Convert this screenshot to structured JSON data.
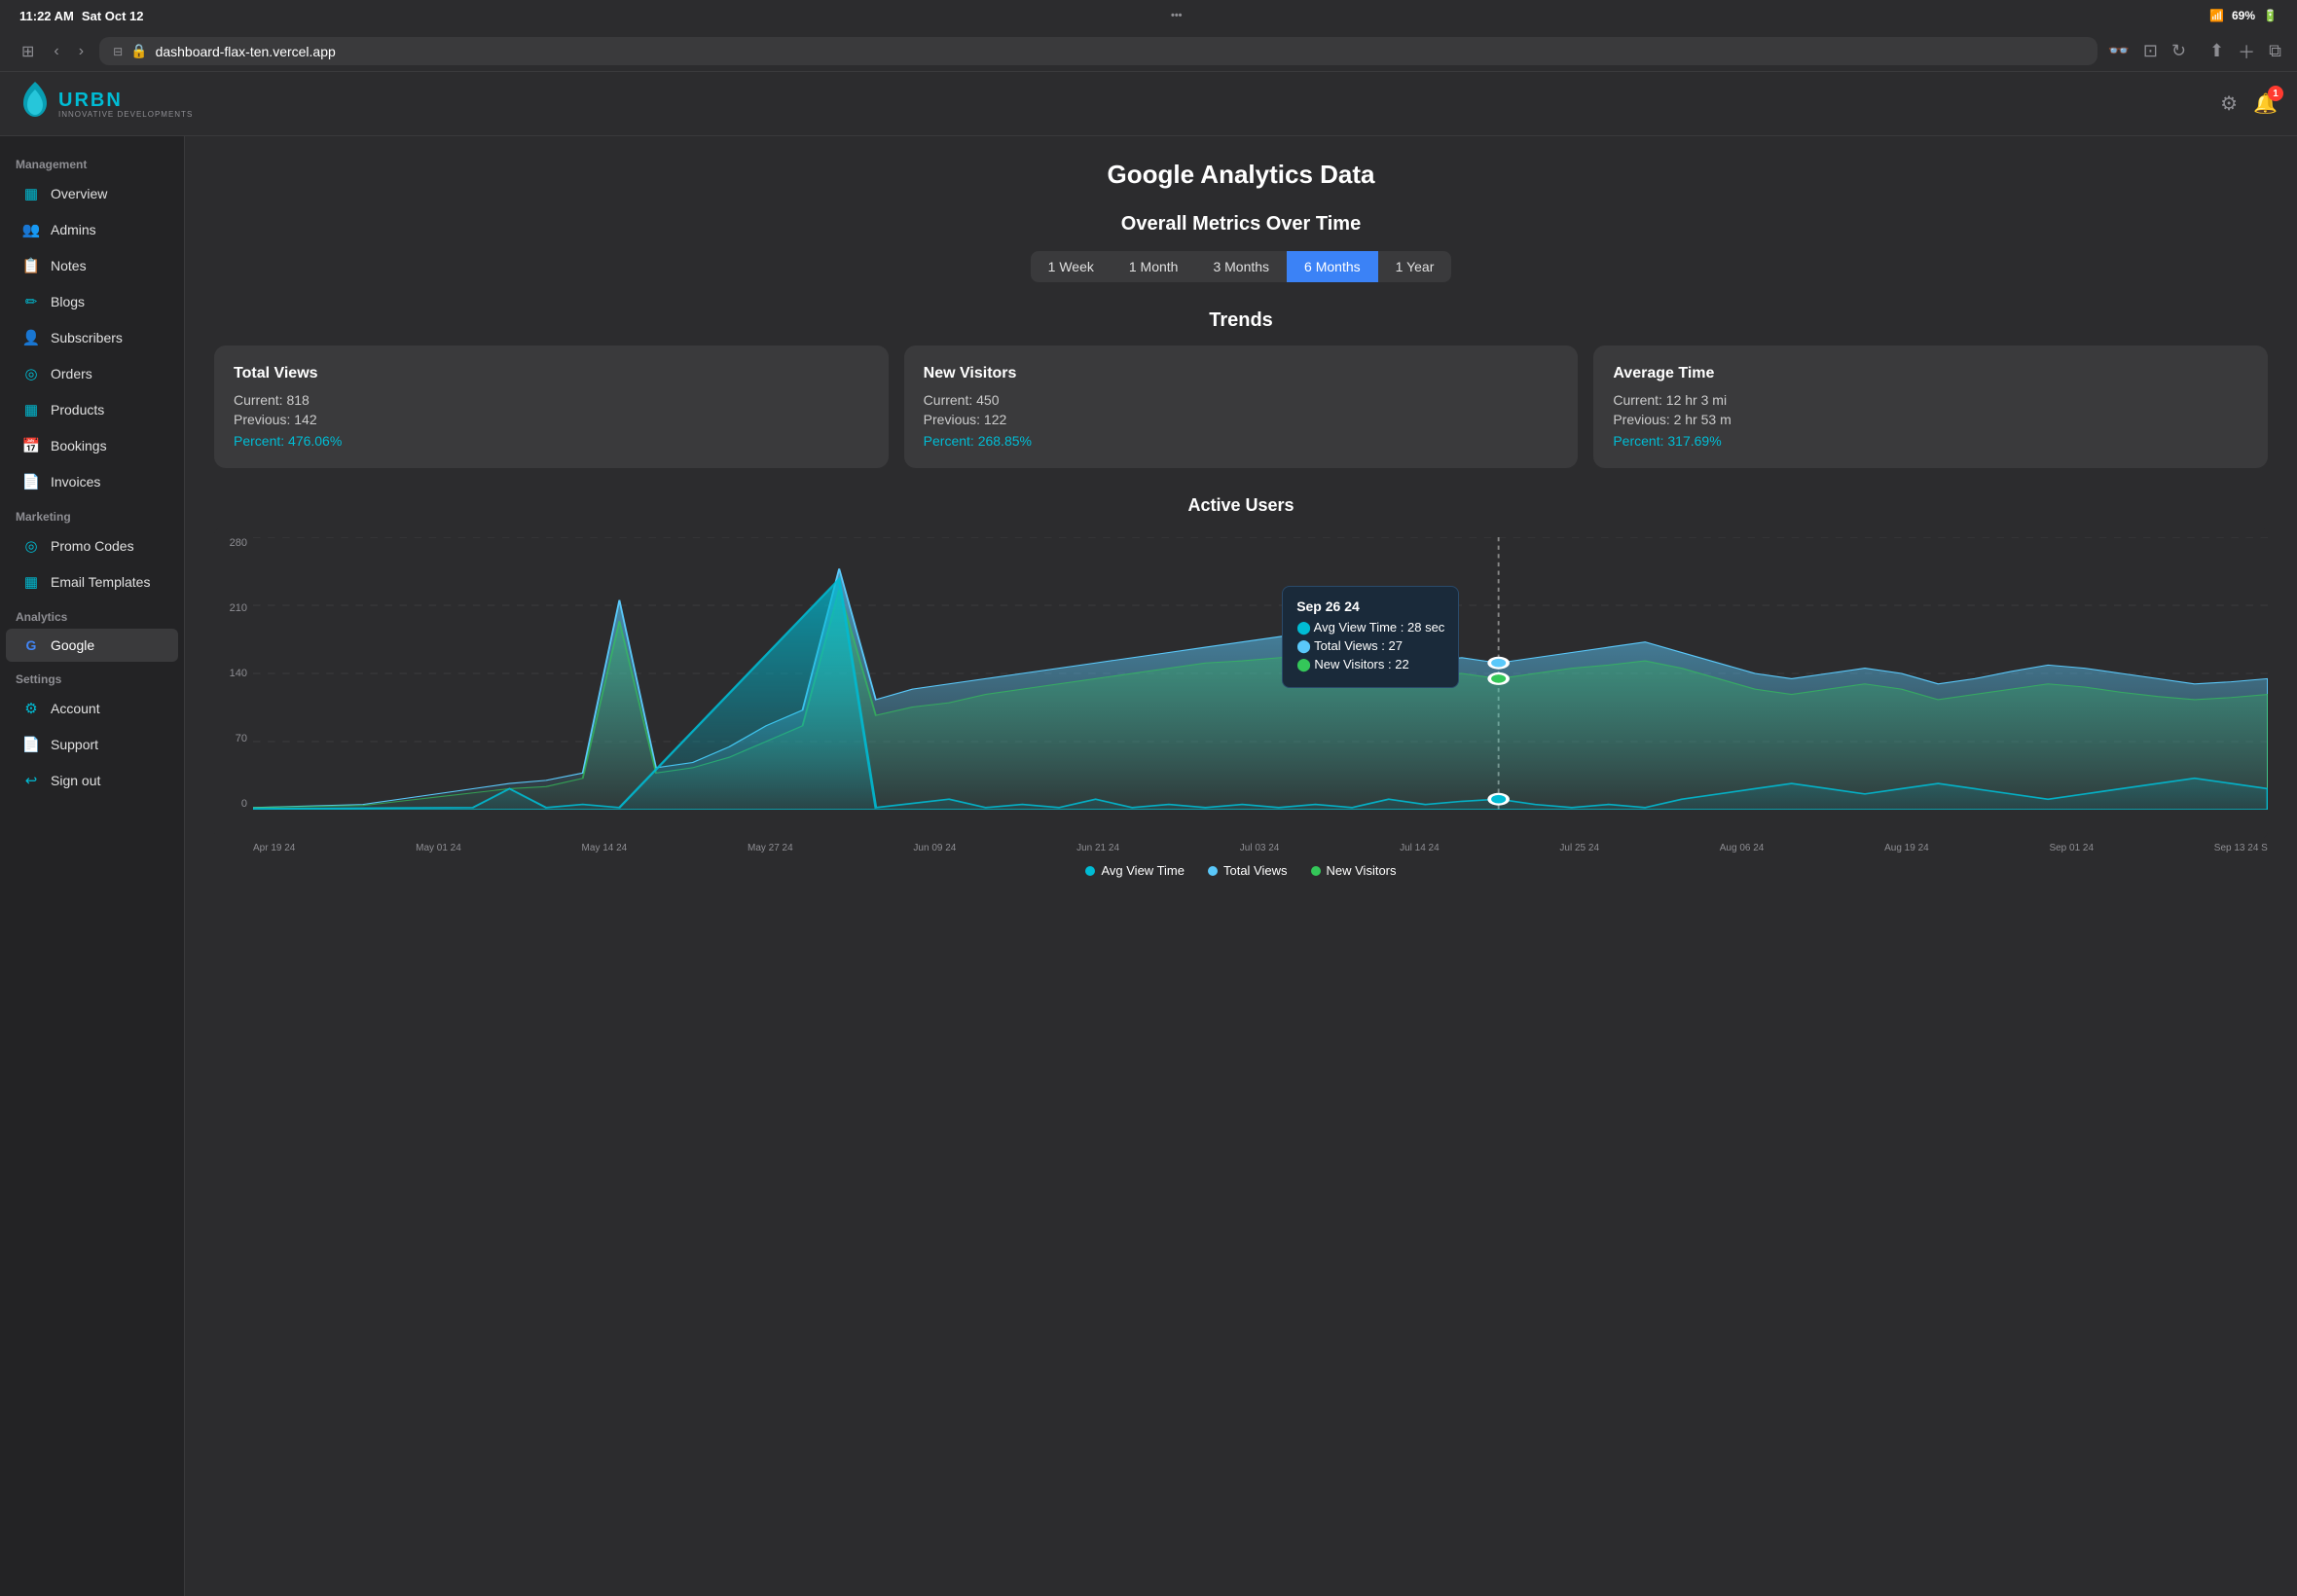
{
  "statusBar": {
    "time": "11:22 AM",
    "date": "Sat Oct 12",
    "wifi": "WiFi",
    "battery": "69%"
  },
  "browserBar": {
    "url": "dashboard-flax-ten.vercel.app",
    "lock_icon": "🔒"
  },
  "appHeader": {
    "logo_text": "URBN",
    "logo_sub": "INNOVATIVE DEVELOPMENTS",
    "settings_icon": "⚙",
    "notification_icon": "🔔",
    "notification_count": "1"
  },
  "sidebar": {
    "management_label": "Management",
    "items_management": [
      {
        "id": "overview",
        "label": "Overview",
        "icon": "▦"
      },
      {
        "id": "admins",
        "label": "Admins",
        "icon": "👥"
      },
      {
        "id": "notes",
        "label": "Notes",
        "icon": "📋"
      },
      {
        "id": "blogs",
        "label": "Blogs",
        "icon": "✏"
      },
      {
        "id": "subscribers",
        "label": "Subscribers",
        "icon": "👤"
      },
      {
        "id": "orders",
        "label": "Orders",
        "icon": "◎"
      },
      {
        "id": "products",
        "label": "Products",
        "icon": "▦"
      },
      {
        "id": "bookings",
        "label": "Bookings",
        "icon": "📅"
      },
      {
        "id": "invoices",
        "label": "Invoices",
        "icon": "📄"
      }
    ],
    "marketing_label": "Marketing",
    "items_marketing": [
      {
        "id": "promo-codes",
        "label": "Promo Codes",
        "icon": "◎"
      },
      {
        "id": "email-templates",
        "label": "Email Templates",
        "icon": "▦"
      }
    ],
    "analytics_label": "Analytics",
    "items_analytics": [
      {
        "id": "google",
        "label": "Google",
        "icon": "G",
        "active": true
      }
    ],
    "settings_label": "Settings",
    "items_settings": [
      {
        "id": "account",
        "label": "Account",
        "icon": "⚙"
      },
      {
        "id": "support",
        "label": "Support",
        "icon": "📄"
      },
      {
        "id": "sign-out",
        "label": "Sign out",
        "icon": "↩"
      }
    ]
  },
  "mainContent": {
    "page_title": "Google Analytics Data",
    "metrics_title": "Overall Metrics Over Time",
    "time_filters": [
      {
        "id": "1week",
        "label": "1 Week",
        "active": false
      },
      {
        "id": "1month",
        "label": "1 Month",
        "active": false
      },
      {
        "id": "3months",
        "label": "3 Months",
        "active": false
      },
      {
        "id": "6months",
        "label": "6 Months",
        "active": true
      },
      {
        "id": "1year",
        "label": "1 Year",
        "active": false
      }
    ],
    "trends_title": "Trends",
    "trend_cards": [
      {
        "title": "Total Views",
        "current_label": "Current: 818",
        "previous_label": "Previous: 142",
        "percent_label": "Percent: 476.06%"
      },
      {
        "title": "New Visitors",
        "current_label": "Current: 450",
        "previous_label": "Previous: 122",
        "percent_label": "Percent: 268.85%"
      },
      {
        "title": "Average Time",
        "current_label": "Current: 12 hr 3 mi",
        "previous_label": "Previous: 2 hr 53 m",
        "percent_label": "Percent: 317.69%"
      }
    ],
    "active_users_title": "Active Users",
    "chart": {
      "y_labels": [
        "280",
        "210",
        "140",
        "70",
        "0"
      ],
      "x_labels": [
        "Apr 19 24",
        "May 01 24",
        "May 14 24",
        "May 27 24",
        "Jun 09 24",
        "Jun 21 24",
        "Jul 03 24",
        "Jul 14 24",
        "Jul 25 24",
        "Aug 06 24",
        "Aug 19 24",
        "Sep 01 24",
        "Sep 13 24 S"
      ],
      "tooltip": {
        "date": "Sep 26 24",
        "avg_view_time": "Avg View Time : 28 sec",
        "total_views": "Total Views : 27",
        "new_visitors": "New Visitors : 22"
      }
    },
    "legend": [
      {
        "id": "avg-view-time",
        "label": "Avg View Time",
        "color": "teal"
      },
      {
        "id": "total-views",
        "label": "Total Views",
        "color": "blue"
      },
      {
        "id": "new-visitors",
        "label": "New Visitors",
        "color": "green"
      }
    ]
  }
}
